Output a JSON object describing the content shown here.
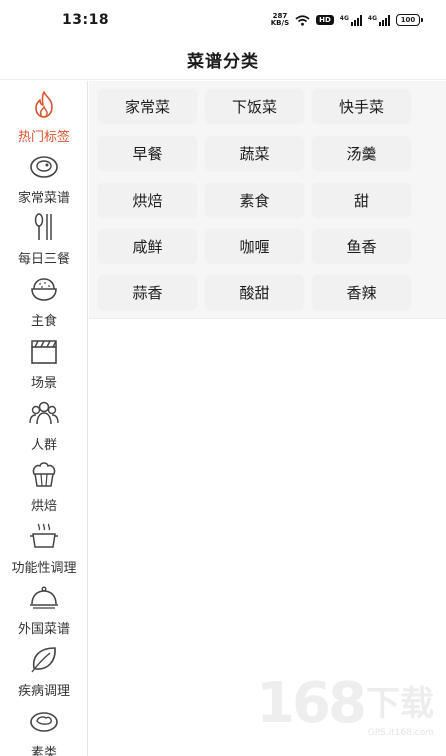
{
  "status_bar": {
    "time": "13:18",
    "net_speed": "287",
    "net_unit": "KB/S",
    "hd": "HD",
    "signal_1": "4G",
    "signal_2": "4G",
    "battery": "100"
  },
  "header": {
    "title": "菜谱分类"
  },
  "sidebar": {
    "active_index": 0,
    "items": [
      {
        "label": "热门标签",
        "icon": "flame-icon"
      },
      {
        "label": "家常菜谱",
        "icon": "plate-icon"
      },
      {
        "label": "每日三餐",
        "icon": "utensils-icon"
      },
      {
        "label": "主食",
        "icon": "rice-bowl-icon"
      },
      {
        "label": "场景",
        "icon": "clapperboard-icon"
      },
      {
        "label": "人群",
        "icon": "people-group-icon"
      },
      {
        "label": "烘焙",
        "icon": "cupcake-icon"
      },
      {
        "label": "功能性调理",
        "icon": "steaming-pot-icon"
      },
      {
        "label": "外国菜谱",
        "icon": "cloche-icon"
      },
      {
        "label": "疾病调理",
        "icon": "leaf-icon"
      },
      {
        "label": "素类",
        "icon": "dish-icon"
      }
    ]
  },
  "tags": [
    "家常菜",
    "下饭菜",
    "快手菜",
    "早餐",
    "蔬菜",
    "汤羹",
    "烘焙",
    "素食",
    "甜",
    "咸鲜",
    "咖喱",
    "鱼香",
    "蒜香",
    "酸甜",
    "香辣"
  ],
  "watermark": {
    "brand_num": "168",
    "brand_cn": "下载",
    "url": "GPS.it168.com"
  },
  "colors": {
    "accent": "#d8542f",
    "content_bg": "#f6f6f6",
    "tag_bg": "#f1f1f1"
  }
}
